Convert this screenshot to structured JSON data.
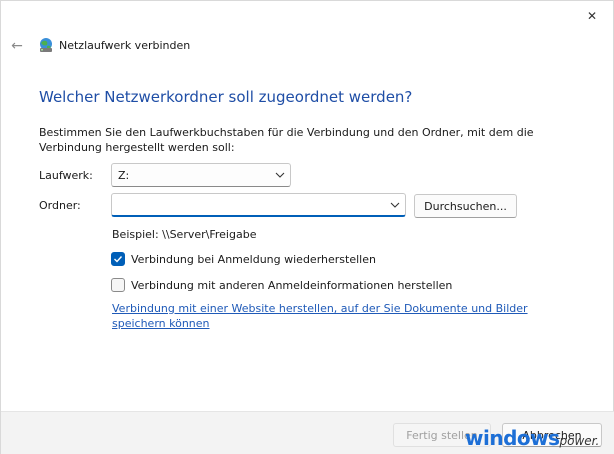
{
  "window": {
    "title": "Netzlaufwerk verbinden",
    "close_label": "✕",
    "back_label": "←"
  },
  "main": {
    "heading": "Welcher Netzwerkordner soll zugeordnet werden?",
    "instructions": "Bestimmen Sie den Laufwerkbuchstaben für die Verbindung und den Ordner, mit dem die Verbindung hergestellt werden soll:",
    "drive_label": "Laufwerk:",
    "drive_value": "Z:",
    "folder_label": "Ordner:",
    "folder_value": "",
    "browse_label": "Durchsuchen...",
    "example": "Beispiel: \\\\Server\\Freigabe",
    "reconnect_label": "Verbindung bei Anmeldung wiederherstellen",
    "reconnect_checked": true,
    "other_credentials_label": "Verbindung mit anderen Anmeldeinformationen herstellen",
    "other_credentials_checked": false,
    "website_link": "Verbindung mit einer Website herstellen, auf der Sie Dokumente und Bilder speichern können"
  },
  "footer": {
    "finish_label": "Fertig stellen",
    "cancel_label": "Abbrechen"
  },
  "watermark": {
    "part1": "windows",
    "part2": "power."
  },
  "colors": {
    "accent": "#005fb8",
    "heading": "#1f4ea6",
    "link": "#1f5ab8"
  }
}
